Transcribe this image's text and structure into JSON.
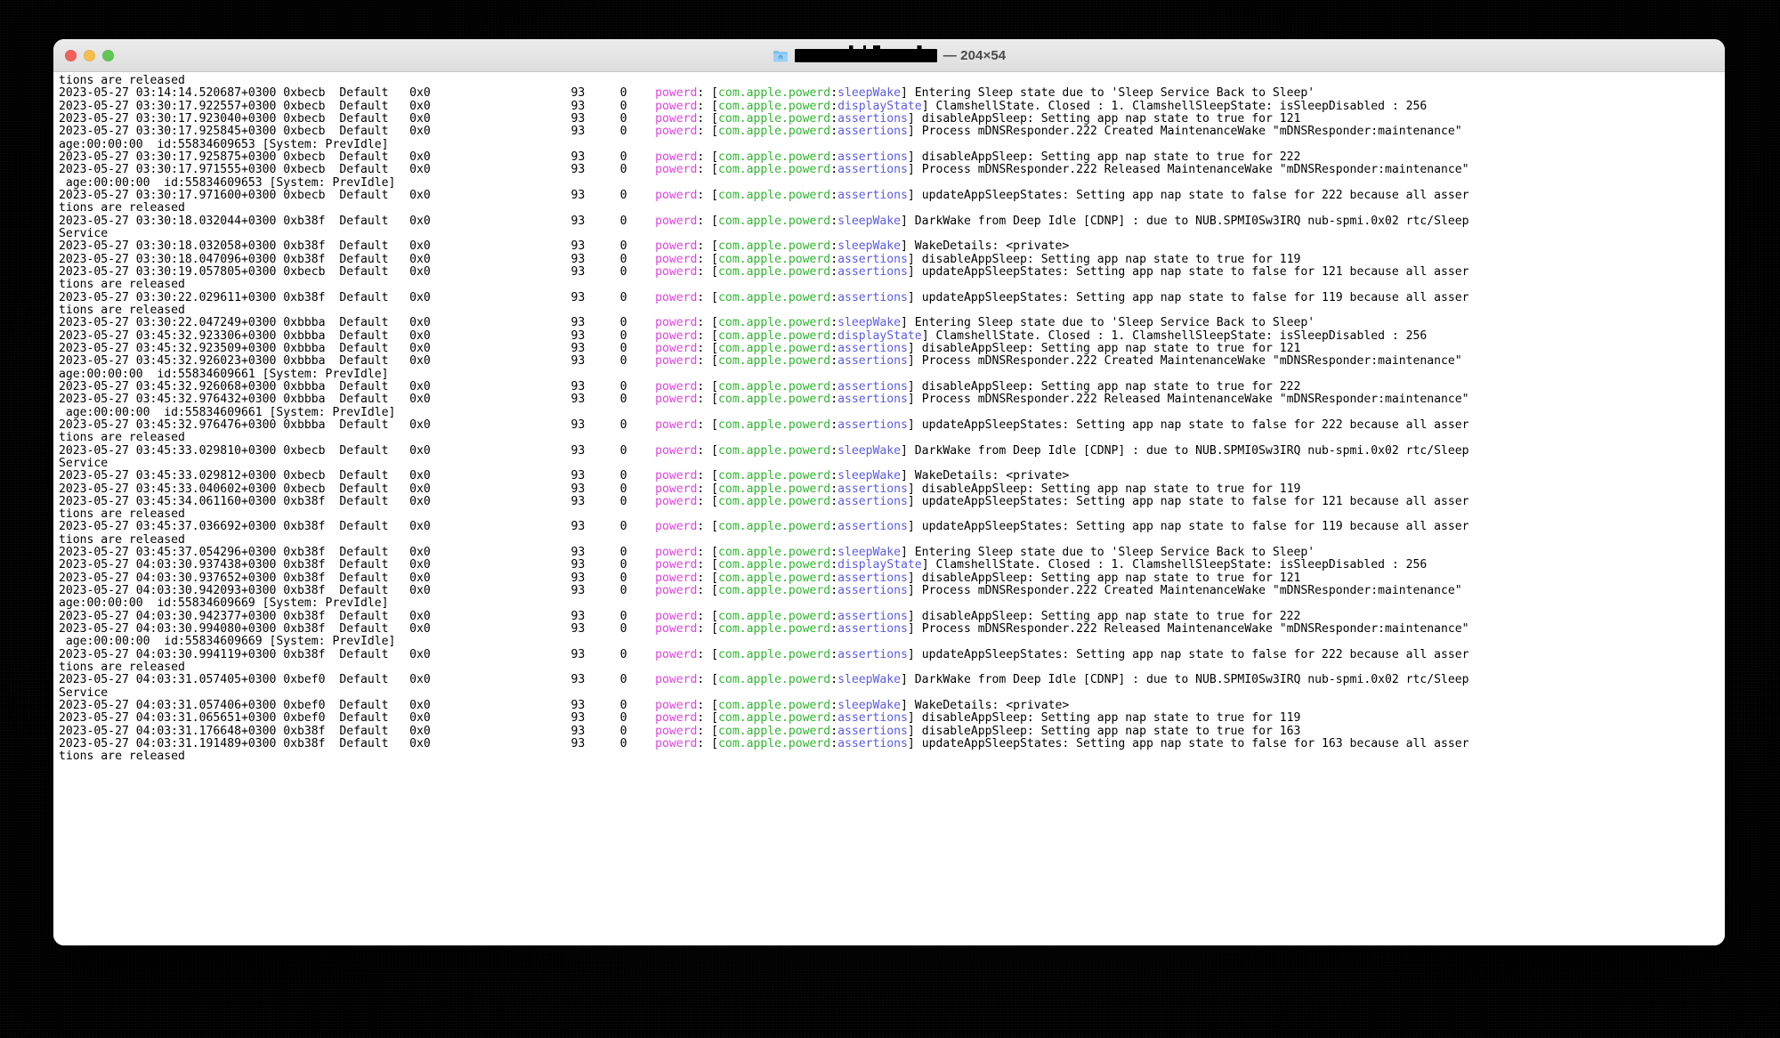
{
  "window": {
    "title_icon": "folder-icon",
    "title_redacted": true,
    "title_dimensions": "— 204×54",
    "traffic_lights": [
      {
        "name": "close",
        "color": "#f2605b"
      },
      {
        "name": "minimize",
        "color": "#f4be4f"
      },
      {
        "name": "zoom",
        "color": "#62c655"
      }
    ]
  },
  "colors": {
    "process": "#e441e4",
    "subsystem": "#2fb62f",
    "category": "#5a5ae8",
    "text": "#000000",
    "background": "#ffffff",
    "titlebar": "#e6e6e6"
  },
  "terminal": {
    "columns": 204,
    "rows": 54,
    "lines": [
      {
        "type": "wrap",
        "text": "tions are released"
      },
      {
        "type": "log",
        "timestamp": "2023-05-27 03:14:14.520687+0300",
        "thread": "0xbecb",
        "level": "Default",
        "activity": "0x0",
        "pid": "93",
        "ttl": "0",
        "process": "powerd",
        "subsystem": "com.apple.powerd",
        "category": "sleepWake",
        "message": "Entering Sleep state due to 'Sleep Service Back to Sleep'"
      },
      {
        "type": "log",
        "timestamp": "2023-05-27 03:30:17.922557+0300",
        "thread": "0xbecb",
        "level": "Default",
        "activity": "0x0",
        "pid": "93",
        "ttl": "0",
        "process": "powerd",
        "subsystem": "com.apple.powerd",
        "category": "displayState",
        "message": "ClamshellState. Closed : 1. ClamshellSleepState: isSleepDisabled : 256"
      },
      {
        "type": "log",
        "timestamp": "2023-05-27 03:30:17.923040+0300",
        "thread": "0xbecb",
        "level": "Default",
        "activity": "0x0",
        "pid": "93",
        "ttl": "0",
        "process": "powerd",
        "subsystem": "com.apple.powerd",
        "category": "assertions",
        "message": "disableAppSleep: Setting app nap state to true for 121"
      },
      {
        "type": "log",
        "timestamp": "2023-05-27 03:30:17.925845+0300",
        "thread": "0xbecb",
        "level": "Default",
        "activity": "0x0",
        "pid": "93",
        "ttl": "0",
        "process": "powerd",
        "subsystem": "com.apple.powerd",
        "category": "assertions",
        "message": "Process mDNSResponder.222 Created MaintenanceWake \"mDNSResponder:maintenance\""
      },
      {
        "type": "wrap",
        "text": "age:00:00:00  id:55834609653 [System: PrevIdle]"
      },
      {
        "type": "log",
        "timestamp": "2023-05-27 03:30:17.925875+0300",
        "thread": "0xbecb",
        "level": "Default",
        "activity": "0x0",
        "pid": "93",
        "ttl": "0",
        "process": "powerd",
        "subsystem": "com.apple.powerd",
        "category": "assertions",
        "message": "disableAppSleep: Setting app nap state to true for 222"
      },
      {
        "type": "log",
        "timestamp": "2023-05-27 03:30:17.971555+0300",
        "thread": "0xbecb",
        "level": "Default",
        "activity": "0x0",
        "pid": "93",
        "ttl": "0",
        "process": "powerd",
        "subsystem": "com.apple.powerd",
        "category": "assertions",
        "message": "Process mDNSResponder.222 Released MaintenanceWake \"mDNSResponder:maintenance\""
      },
      {
        "type": "wrap",
        "text": " age:00:00:00  id:55834609653 [System: PrevIdle]"
      },
      {
        "type": "log",
        "timestamp": "2023-05-27 03:30:17.971600+0300",
        "thread": "0xbecb",
        "level": "Default",
        "activity": "0x0",
        "pid": "93",
        "ttl": "0",
        "process": "powerd",
        "subsystem": "com.apple.powerd",
        "category": "assertions",
        "message": "updateAppSleepStates: Setting app nap state to false for 222 because all asser"
      },
      {
        "type": "wrap",
        "text": "tions are released"
      },
      {
        "type": "log",
        "timestamp": "2023-05-27 03:30:18.032044+0300",
        "thread": "0xb38f",
        "level": "Default",
        "activity": "0x0",
        "pid": "93",
        "ttl": "0",
        "process": "powerd",
        "subsystem": "com.apple.powerd",
        "category": "sleepWake",
        "message": "DarkWake from Deep Idle [CDNP] : due to NUB.SPMI0Sw3IRQ nub-spmi.0x02 rtc/Sleep"
      },
      {
        "type": "wrap",
        "text": "Service"
      },
      {
        "type": "log",
        "timestamp": "2023-05-27 03:30:18.032058+0300",
        "thread": "0xb38f",
        "level": "Default",
        "activity": "0x0",
        "pid": "93",
        "ttl": "0",
        "process": "powerd",
        "subsystem": "com.apple.powerd",
        "category": "sleepWake",
        "message": "WakeDetails: <private>"
      },
      {
        "type": "log",
        "timestamp": "2023-05-27 03:30:18.047096+0300",
        "thread": "0xb38f",
        "level": "Default",
        "activity": "0x0",
        "pid": "93",
        "ttl": "0",
        "process": "powerd",
        "subsystem": "com.apple.powerd",
        "category": "assertions",
        "message": "disableAppSleep: Setting app nap state to true for 119"
      },
      {
        "type": "log",
        "timestamp": "2023-05-27 03:30:19.057805+0300",
        "thread": "0xbecb",
        "level": "Default",
        "activity": "0x0",
        "pid": "93",
        "ttl": "0",
        "process": "powerd",
        "subsystem": "com.apple.powerd",
        "category": "assertions",
        "message": "updateAppSleepStates: Setting app nap state to false for 121 because all asser"
      },
      {
        "type": "wrap",
        "text": "tions are released"
      },
      {
        "type": "log",
        "timestamp": "2023-05-27 03:30:22.029611+0300",
        "thread": "0xb38f",
        "level": "Default",
        "activity": "0x0",
        "pid": "93",
        "ttl": "0",
        "process": "powerd",
        "subsystem": "com.apple.powerd",
        "category": "assertions",
        "message": "updateAppSleepStates: Setting app nap state to false for 119 because all asser"
      },
      {
        "type": "wrap",
        "text": "tions are released"
      },
      {
        "type": "log",
        "timestamp": "2023-05-27 03:30:22.047249+0300",
        "thread": "0xbbba",
        "level": "Default",
        "activity": "0x0",
        "pid": "93",
        "ttl": "0",
        "process": "powerd",
        "subsystem": "com.apple.powerd",
        "category": "sleepWake",
        "message": "Entering Sleep state due to 'Sleep Service Back to Sleep'"
      },
      {
        "type": "log",
        "timestamp": "2023-05-27 03:45:32.923306+0300",
        "thread": "0xbbba",
        "level": "Default",
        "activity": "0x0",
        "pid": "93",
        "ttl": "0",
        "process": "powerd",
        "subsystem": "com.apple.powerd",
        "category": "displayState",
        "message": "ClamshellState. Closed : 1. ClamshellSleepState: isSleepDisabled : 256"
      },
      {
        "type": "log",
        "timestamp": "2023-05-27 03:45:32.923509+0300",
        "thread": "0xbbba",
        "level": "Default",
        "activity": "0x0",
        "pid": "93",
        "ttl": "0",
        "process": "powerd",
        "subsystem": "com.apple.powerd",
        "category": "assertions",
        "message": "disableAppSleep: Setting app nap state to true for 121"
      },
      {
        "type": "log",
        "timestamp": "2023-05-27 03:45:32.926023+0300",
        "thread": "0xbbba",
        "level": "Default",
        "activity": "0x0",
        "pid": "93",
        "ttl": "0",
        "process": "powerd",
        "subsystem": "com.apple.powerd",
        "category": "assertions",
        "message": "Process mDNSResponder.222 Created MaintenanceWake \"mDNSResponder:maintenance\""
      },
      {
        "type": "wrap",
        "text": "age:00:00:00  id:55834609661 [System: PrevIdle]"
      },
      {
        "type": "log",
        "timestamp": "2023-05-27 03:45:32.926068+0300",
        "thread": "0xbbba",
        "level": "Default",
        "activity": "0x0",
        "pid": "93",
        "ttl": "0",
        "process": "powerd",
        "subsystem": "com.apple.powerd",
        "category": "assertions",
        "message": "disableAppSleep: Setting app nap state to true for 222"
      },
      {
        "type": "log",
        "timestamp": "2023-05-27 03:45:32.976432+0300",
        "thread": "0xbbba",
        "level": "Default",
        "activity": "0x0",
        "pid": "93",
        "ttl": "0",
        "process": "powerd",
        "subsystem": "com.apple.powerd",
        "category": "assertions",
        "message": "Process mDNSResponder.222 Released MaintenanceWake \"mDNSResponder:maintenance\""
      },
      {
        "type": "wrap",
        "text": " age:00:00:00  id:55834609661 [System: PrevIdle]"
      },
      {
        "type": "log",
        "timestamp": "2023-05-27 03:45:32.976476+0300",
        "thread": "0xbbba",
        "level": "Default",
        "activity": "0x0",
        "pid": "93",
        "ttl": "0",
        "process": "powerd",
        "subsystem": "com.apple.powerd",
        "category": "assertions",
        "message": "updateAppSleepStates: Setting app nap state to false for 222 because all asser"
      },
      {
        "type": "wrap",
        "text": "tions are released"
      },
      {
        "type": "log",
        "timestamp": "2023-05-27 03:45:33.029810+0300",
        "thread": "0xbecb",
        "level": "Default",
        "activity": "0x0",
        "pid": "93",
        "ttl": "0",
        "process": "powerd",
        "subsystem": "com.apple.powerd",
        "category": "sleepWake",
        "message": "DarkWake from Deep Idle [CDNP] : due to NUB.SPMI0Sw3IRQ nub-spmi.0x02 rtc/Sleep"
      },
      {
        "type": "wrap",
        "text": "Service"
      },
      {
        "type": "log",
        "timestamp": "2023-05-27 03:45:33.029812+0300",
        "thread": "0xbecb",
        "level": "Default",
        "activity": "0x0",
        "pid": "93",
        "ttl": "0",
        "process": "powerd",
        "subsystem": "com.apple.powerd",
        "category": "sleepWake",
        "message": "WakeDetails: <private>"
      },
      {
        "type": "log",
        "timestamp": "2023-05-27 03:45:33.040602+0300",
        "thread": "0xbecb",
        "level": "Default",
        "activity": "0x0",
        "pid": "93",
        "ttl": "0",
        "process": "powerd",
        "subsystem": "com.apple.powerd",
        "category": "assertions",
        "message": "disableAppSleep: Setting app nap state to true for 119"
      },
      {
        "type": "log",
        "timestamp": "2023-05-27 03:45:34.061160+0300",
        "thread": "0xb38f",
        "level": "Default",
        "activity": "0x0",
        "pid": "93",
        "ttl": "0",
        "process": "powerd",
        "subsystem": "com.apple.powerd",
        "category": "assertions",
        "message": "updateAppSleepStates: Setting app nap state to false for 121 because all asser"
      },
      {
        "type": "wrap",
        "text": "tions are released"
      },
      {
        "type": "log",
        "timestamp": "2023-05-27 03:45:37.036692+0300",
        "thread": "0xb38f",
        "level": "Default",
        "activity": "0x0",
        "pid": "93",
        "ttl": "0",
        "process": "powerd",
        "subsystem": "com.apple.powerd",
        "category": "assertions",
        "message": "updateAppSleepStates: Setting app nap state to false for 119 because all asser"
      },
      {
        "type": "wrap",
        "text": "tions are released"
      },
      {
        "type": "log",
        "timestamp": "2023-05-27 03:45:37.054296+0300",
        "thread": "0xb38f",
        "level": "Default",
        "activity": "0x0",
        "pid": "93",
        "ttl": "0",
        "process": "powerd",
        "subsystem": "com.apple.powerd",
        "category": "sleepWake",
        "message": "Entering Sleep state due to 'Sleep Service Back to Sleep'"
      },
      {
        "type": "log",
        "timestamp": "2023-05-27 04:03:30.937438+0300",
        "thread": "0xb38f",
        "level": "Default",
        "activity": "0x0",
        "pid": "93",
        "ttl": "0",
        "process": "powerd",
        "subsystem": "com.apple.powerd",
        "category": "displayState",
        "message": "ClamshellState. Closed : 1. ClamshellSleepState: isSleepDisabled : 256"
      },
      {
        "type": "log",
        "timestamp": "2023-05-27 04:03:30.937652+0300",
        "thread": "0xb38f",
        "level": "Default",
        "activity": "0x0",
        "pid": "93",
        "ttl": "0",
        "process": "powerd",
        "subsystem": "com.apple.powerd",
        "category": "assertions",
        "message": "disableAppSleep: Setting app nap state to true for 121"
      },
      {
        "type": "log",
        "timestamp": "2023-05-27 04:03:30.942093+0300",
        "thread": "0xb38f",
        "level": "Default",
        "activity": "0x0",
        "pid": "93",
        "ttl": "0",
        "process": "powerd",
        "subsystem": "com.apple.powerd",
        "category": "assertions",
        "message": "Process mDNSResponder.222 Created MaintenanceWake \"mDNSResponder:maintenance\""
      },
      {
        "type": "wrap",
        "text": "age:00:00:00  id:55834609669 [System: PrevIdle]"
      },
      {
        "type": "log",
        "timestamp": "2023-05-27 04:03:30.942377+0300",
        "thread": "0xb38f",
        "level": "Default",
        "activity": "0x0",
        "pid": "93",
        "ttl": "0",
        "process": "powerd",
        "subsystem": "com.apple.powerd",
        "category": "assertions",
        "message": "disableAppSleep: Setting app nap state to true for 222"
      },
      {
        "type": "log",
        "timestamp": "2023-05-27 04:03:30.994080+0300",
        "thread": "0xb38f",
        "level": "Default",
        "activity": "0x0",
        "pid": "93",
        "ttl": "0",
        "process": "powerd",
        "subsystem": "com.apple.powerd",
        "category": "assertions",
        "message": "Process mDNSResponder.222 Released MaintenanceWake \"mDNSResponder:maintenance\""
      },
      {
        "type": "wrap",
        "text": " age:00:00:00  id:55834609669 [System: PrevIdle]"
      },
      {
        "type": "log",
        "timestamp": "2023-05-27 04:03:30.994119+0300",
        "thread": "0xb38f",
        "level": "Default",
        "activity": "0x0",
        "pid": "93",
        "ttl": "0",
        "process": "powerd",
        "subsystem": "com.apple.powerd",
        "category": "assertions",
        "message": "updateAppSleepStates: Setting app nap state to false for 222 because all asser"
      },
      {
        "type": "wrap",
        "text": "tions are released"
      },
      {
        "type": "log",
        "timestamp": "2023-05-27 04:03:31.057405+0300",
        "thread": "0xbef0",
        "level": "Default",
        "activity": "0x0",
        "pid": "93",
        "ttl": "0",
        "process": "powerd",
        "subsystem": "com.apple.powerd",
        "category": "sleepWake",
        "message": "DarkWake from Deep Idle [CDNP] : due to NUB.SPMI0Sw3IRQ nub-spmi.0x02 rtc/Sleep"
      },
      {
        "type": "wrap",
        "text": "Service"
      },
      {
        "type": "log",
        "timestamp": "2023-05-27 04:03:31.057406+0300",
        "thread": "0xbef0",
        "level": "Default",
        "activity": "0x0",
        "pid": "93",
        "ttl": "0",
        "process": "powerd",
        "subsystem": "com.apple.powerd",
        "category": "sleepWake",
        "message": "WakeDetails: <private>"
      },
      {
        "type": "log",
        "timestamp": "2023-05-27 04:03:31.065651+0300",
        "thread": "0xbef0",
        "level": "Default",
        "activity": "0x0",
        "pid": "93",
        "ttl": "0",
        "process": "powerd",
        "subsystem": "com.apple.powerd",
        "category": "assertions",
        "message": "disableAppSleep: Setting app nap state to true for 119"
      },
      {
        "type": "log",
        "timestamp": "2023-05-27 04:03:31.176648+0300",
        "thread": "0xb38f",
        "level": "Default",
        "activity": "0x0",
        "pid": "93",
        "ttl": "0",
        "process": "powerd",
        "subsystem": "com.apple.powerd",
        "category": "assertions",
        "message": "disableAppSleep: Setting app nap state to true for 163"
      },
      {
        "type": "log",
        "timestamp": "2023-05-27 04:03:31.191489+0300",
        "thread": "0xb38f",
        "level": "Default",
        "activity": "0x0",
        "pid": "93",
        "ttl": "0",
        "process": "powerd",
        "subsystem": "com.apple.powerd",
        "category": "assertions",
        "message": "updateAppSleepStates: Setting app nap state to false for 163 because all asser"
      },
      {
        "type": "wrap",
        "text": "tions are released"
      }
    ]
  }
}
